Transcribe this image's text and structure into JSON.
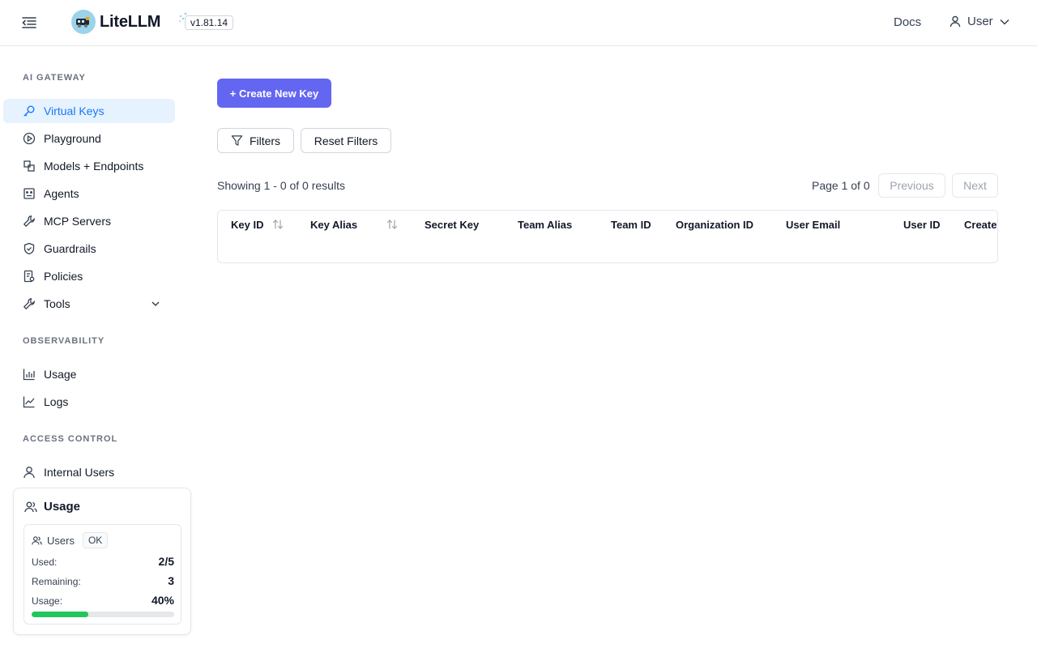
{
  "header": {
    "app_name": "LiteLLM",
    "version": "v1.81.14",
    "docs_label": "Docs",
    "user_label": "User"
  },
  "sidebar": {
    "sections": [
      {
        "title": "AI GATEWAY",
        "items": [
          {
            "label": "Virtual Keys",
            "icon": "key-icon",
            "active": true
          },
          {
            "label": "Playground",
            "icon": "play-circle-icon"
          },
          {
            "label": "Models + Endpoints",
            "icon": "models-icon"
          },
          {
            "label": "Agents",
            "icon": "robot-icon"
          },
          {
            "label": "MCP Servers",
            "icon": "wrench-icon"
          },
          {
            "label": "Guardrails",
            "icon": "shield-icon"
          },
          {
            "label": "Policies",
            "icon": "policy-icon"
          },
          {
            "label": "Tools",
            "icon": "tool-icon",
            "expandable": true
          }
        ]
      },
      {
        "title": "OBSERVABILITY",
        "items": [
          {
            "label": "Usage",
            "icon": "bar-chart-icon"
          },
          {
            "label": "Logs",
            "icon": "line-chart-icon"
          }
        ]
      },
      {
        "title": "ACCESS CONTROL",
        "items": [
          {
            "label": "Internal Users",
            "icon": "user-icon"
          }
        ]
      }
    ]
  },
  "usage_card": {
    "title": "Usage",
    "resource_label": "Users",
    "status": "OK",
    "used_label": "Used:",
    "used_value": "2/5",
    "remaining_label": "Remaining:",
    "remaining_value": "3",
    "usage_label": "Usage:",
    "usage_value": "40%",
    "usage_fraction": 0.4,
    "bar_color": "#22c55e"
  },
  "main": {
    "create_button": "+ Create New Key",
    "filters_button": "Filters",
    "reset_filters_button": "Reset Filters",
    "showing_text": "Showing 1 - 0 of 0 results",
    "page_text": "Page 1 of 0",
    "previous_button": "Previous",
    "next_button": "Next",
    "columns": [
      "Key ID",
      "Key Alias",
      "Secret Key",
      "Team Alias",
      "Team ID",
      "Organization ID",
      "User Email",
      "User ID",
      "Create"
    ]
  },
  "colors": {
    "accent": "#6366f1",
    "active_nav_bg": "#e6f2fd",
    "active_nav_text": "#1677ff"
  }
}
